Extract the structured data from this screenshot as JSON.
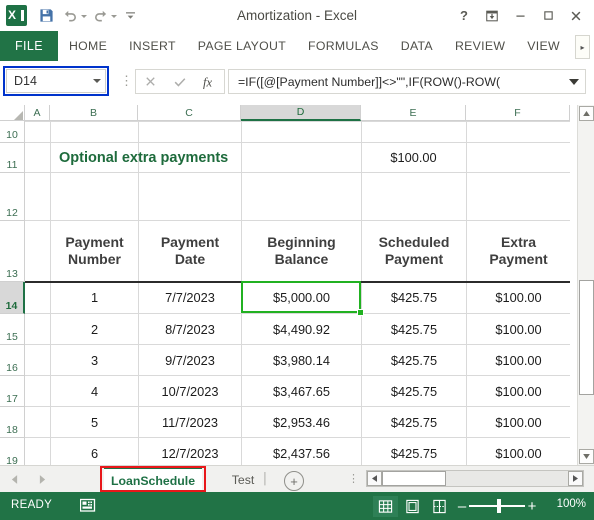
{
  "window": {
    "title": "Amortization - Excel",
    "logo_icon": "excel-logo-icon",
    "quick_access": [
      {
        "name": "save-icon",
        "label": "Save"
      },
      {
        "name": "undo-icon",
        "label": "Undo"
      },
      {
        "name": "redo-icon",
        "label": "Redo"
      },
      {
        "name": "customize-quick-access-icon",
        "label": "Customize Quick Access Toolbar"
      }
    ],
    "controls": [
      {
        "name": "help-button",
        "glyph": "?"
      },
      {
        "name": "ribbon-display-options-button",
        "glyph": "⤓"
      },
      {
        "name": "minimize-button",
        "glyph": "–"
      },
      {
        "name": "maximize-button",
        "glyph": "□"
      },
      {
        "name": "close-button",
        "glyph": "✕"
      }
    ]
  },
  "ribbon": {
    "file_tab": "FILE",
    "tabs": [
      "HOME",
      "INSERT",
      "PAGE LAYOUT",
      "FORMULAS",
      "DATA",
      "REVIEW",
      "VIEW"
    ],
    "scroll_right": "▸"
  },
  "formula_bar": {
    "name_box_value": "D14",
    "cancel_icon": "cancel-icon",
    "enter_icon": "enter-icon",
    "function_icon": "insert-function-icon",
    "formula": "=IF([@[Payment Number]]<>\"\",IF(ROW()-ROW(",
    "expand_icon": "expand-formula-bar-icon"
  },
  "grid": {
    "columns": [
      "A",
      "B",
      "C",
      "D",
      "E",
      "F"
    ],
    "selected_column": "D",
    "rows": [
      "10",
      "11",
      "12",
      "13",
      "14",
      "15",
      "16",
      "17",
      "18",
      "19"
    ],
    "selected_row": "14",
    "selected_cell": "D14",
    "summary": {
      "label": "Optional extra payments",
      "value": "$100.00"
    },
    "table_headers": [
      {
        "line1": "Payment",
        "line2": "Number"
      },
      {
        "line1": "Payment",
        "line2": "Date"
      },
      {
        "line1": "Beginning",
        "line2": "Balance"
      },
      {
        "line1": "Scheduled",
        "line2": "Payment"
      },
      {
        "line1": "Extra",
        "line2": "Payment"
      }
    ],
    "table_rows": [
      {
        "row": "14",
        "number": "1",
        "date": "7/7/2023",
        "beginning_balance": "$5,000.00",
        "scheduled_payment": "$425.75",
        "extra_payment": "$100.00"
      },
      {
        "row": "15",
        "number": "2",
        "date": "8/7/2023",
        "beginning_balance": "$4,490.92",
        "scheduled_payment": "$425.75",
        "extra_payment": "$100.00"
      },
      {
        "row": "16",
        "number": "3",
        "date": "9/7/2023",
        "beginning_balance": "$3,980.14",
        "scheduled_payment": "$425.75",
        "extra_payment": "$100.00"
      },
      {
        "row": "17",
        "number": "4",
        "date": "10/7/2023",
        "beginning_balance": "$3,467.65",
        "scheduled_payment": "$425.75",
        "extra_payment": "$100.00"
      },
      {
        "row": "18",
        "number": "5",
        "date": "11/7/2023",
        "beginning_balance": "$2,953.46",
        "scheduled_payment": "$425.75",
        "extra_payment": "$100.00"
      },
      {
        "row": "19",
        "number": "6",
        "date": "12/7/2023",
        "beginning_balance": "$2,437.56",
        "scheduled_payment": "$425.75",
        "extra_payment": "$100.00"
      }
    ]
  },
  "sheet_tabs": {
    "prev_icon": "previous-sheet-icon",
    "next_icon": "next-sheet-icon",
    "tabs": [
      {
        "label": "LoanSchedule",
        "active": true,
        "highlighted": true
      },
      {
        "label": "Test",
        "active": false,
        "highlighted": false
      }
    ],
    "new_sheet_icon": "new-sheet-icon",
    "new_sheet_glyph": "+"
  },
  "status_bar": {
    "mode": "READY",
    "macro_icon": "record-macro-icon",
    "views": [
      {
        "name": "normal-view-button",
        "active": true
      },
      {
        "name": "page-layout-view-button",
        "active": false
      },
      {
        "name": "page-break-preview-button",
        "active": false
      }
    ],
    "zoom_out": "–",
    "zoom_in": "+",
    "zoom_level": "100%"
  },
  "colors": {
    "excel_green": "#217346",
    "title_green": "#1e6b3c",
    "selection_green": "#21b121",
    "namebox_highlight": "#0033cc",
    "tab_highlight": "#e8171a"
  }
}
